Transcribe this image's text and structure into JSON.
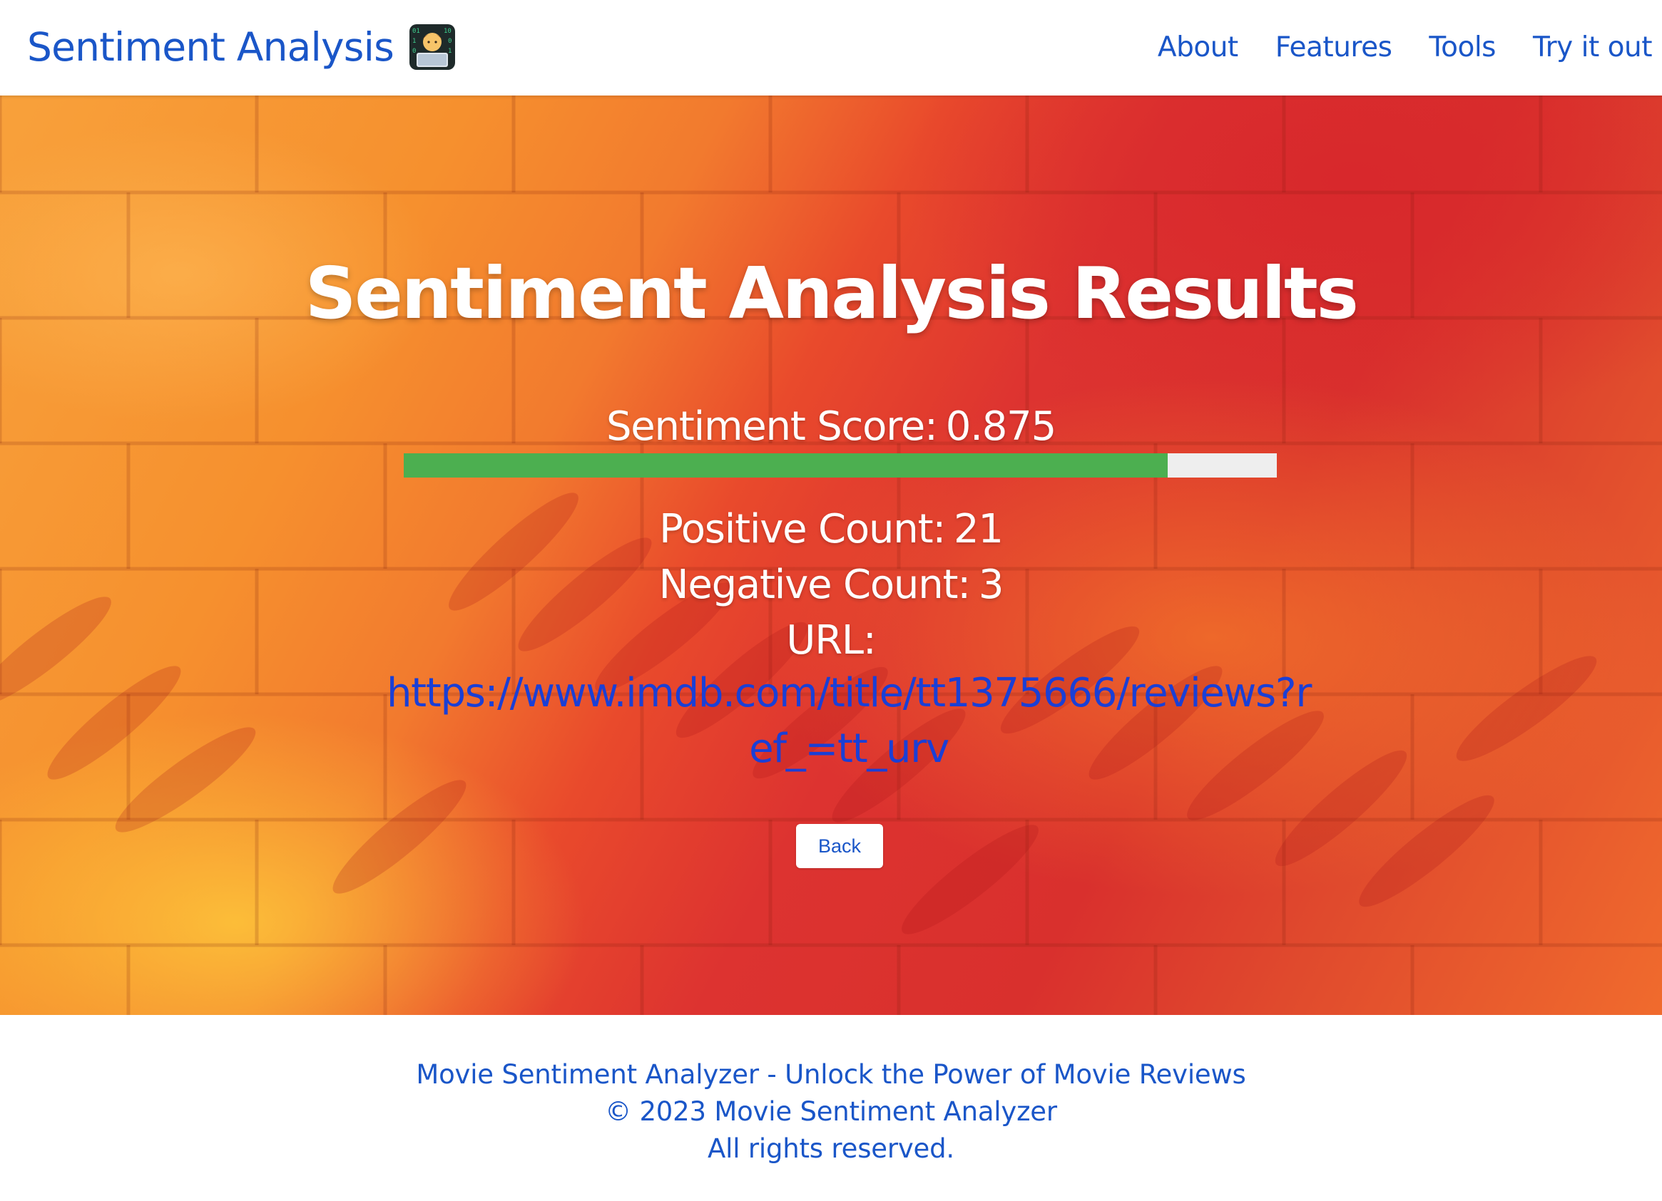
{
  "header": {
    "brand_title": "Sentiment Analysis",
    "brand_emoji_icon": "technologist-icon",
    "nav": [
      {
        "label": "About"
      },
      {
        "label": "Features"
      },
      {
        "label": "Tools"
      },
      {
        "label": "Try it out"
      }
    ]
  },
  "results": {
    "title": "Sentiment Analysis Results",
    "score_label": "Sentiment Score:",
    "score_value": "0.875",
    "score_fraction": 0.875,
    "positive_label": "Positive Count:",
    "positive_value": "21",
    "negative_label": "Negative Count:",
    "negative_value": "3",
    "url_label": "URL:",
    "url": "https://www.imdb.com/title/tt1375666/reviews?ref_=tt_urv",
    "back_label": "Back"
  },
  "footer": {
    "line1": "Movie Sentiment Analyzer - Unlock the Power of Movie Reviews",
    "line2": "© 2023 Movie Sentiment Analyzer",
    "line3": "All rights reserved."
  },
  "colors": {
    "accent": "#1a56c8",
    "link": "#1a3fd6",
    "score_bar_fill": "#4caf50",
    "score_bar_track": "#eeeeee",
    "hero_orange": "#f6902e",
    "hero_red": "#d9302d"
  }
}
